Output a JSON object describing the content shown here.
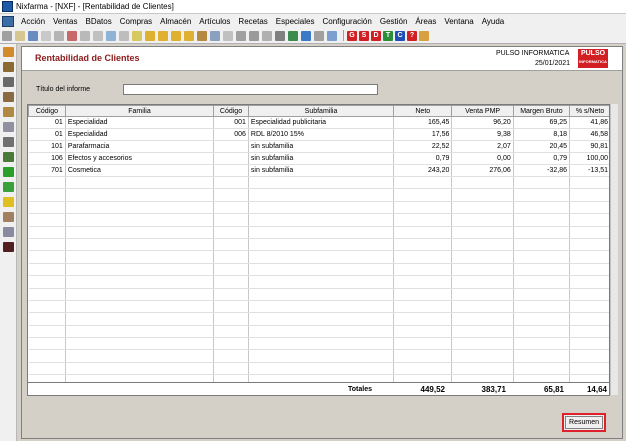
{
  "window": {
    "title": "Nixfarma - [NXF] - [Rentabilidad de Clientes]"
  },
  "menu": [
    {
      "label": "Acción",
      "disabled": false
    },
    {
      "label": "Ventas",
      "disabled": false
    },
    {
      "label": "BDatos",
      "disabled": false
    },
    {
      "label": "Compras",
      "disabled": false
    },
    {
      "label": "Almacén",
      "disabled": false
    },
    {
      "label": "Artículos",
      "disabled": false
    },
    {
      "label": "Recetas",
      "disabled": false
    },
    {
      "label": "Especiales",
      "disabled": false
    },
    {
      "label": "Configuración",
      "disabled": false
    },
    {
      "label": "Gestión",
      "disabled": false
    },
    {
      "label": "Áreas",
      "disabled": false
    },
    {
      "label": "Ventana",
      "disabled": false
    },
    {
      "label": "Ayuda",
      "disabled": false
    }
  ],
  "toolbar_letters": [
    {
      "label": "G",
      "color": "#d21f24"
    },
    {
      "label": "S",
      "color": "#d21f24"
    },
    {
      "label": "D",
      "color": "#d21f24"
    },
    {
      "label": "T",
      "color": "#2a8f3a"
    },
    {
      "label": "C",
      "color": "#1f4fb5"
    },
    {
      "label": "?",
      "color": "#d21f24"
    }
  ],
  "report": {
    "title": "Rentabilidad de Clientes",
    "company": "PULSO INFORMATICA",
    "date": "25/01/2021",
    "logo_text": "PULSO",
    "logo_sub": "INFORMATICA",
    "name_label": "Título del informe",
    "name_value": ""
  },
  "table": {
    "headers": [
      "Código",
      "Familia",
      "Código",
      "Subfamilia",
      "Neto",
      "Venta PMP",
      "Margen Bruto",
      "% s/Neto"
    ],
    "rows": [
      [
        "01",
        "Especialidad",
        "001",
        "Especialidad publicitaria",
        "165,45",
        "96,20",
        "69,25",
        "41,86"
      ],
      [
        "01",
        "Especialidad",
        "006",
        "RDL 8/2010 15%",
        "17,56",
        "9,38",
        "8,18",
        "46,58"
      ],
      [
        "101",
        "Parafarmacia",
        "",
        "sin subfamilia",
        "22,52",
        "2,07",
        "20,45",
        "90,81"
      ],
      [
        "106",
        "Efectos y accesorios",
        "",
        "sin subfamilia",
        "0,79",
        "0,00",
        "0,79",
        "100,00"
      ],
      [
        "701",
        "Cosmetica",
        "",
        "sin subfamilia",
        "243,20",
        "276,06",
        "-32,86",
        "-13,51"
      ]
    ]
  },
  "totals": {
    "label": "Totales",
    "neto": "449,52",
    "venta_pmp": "383,71",
    "margen_bruto": "65,81",
    "pct": "14,64"
  },
  "buttons": {
    "resumen": "Resumen"
  },
  "colors": {
    "accent": "#8b1a1a",
    "brand_red": "#d21f24",
    "highlight": "#e0212b"
  }
}
